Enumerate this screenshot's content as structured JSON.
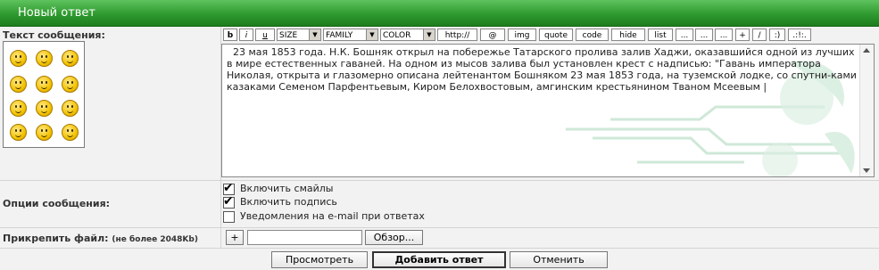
{
  "header": {
    "title": "Новый ответ"
  },
  "labels": {
    "message_text": "Текст сообщения:",
    "options": "Опции сообщения:",
    "attach": "Прикрепить файл:",
    "attach_limit": "(не более 2048Kb)"
  },
  "smilies": [
    "smile-icon",
    "grin-icon",
    "cool-icon",
    "scared-icon",
    "unsure-icon",
    "happy-icon",
    "sad-icon",
    "blink-icon",
    "shocked-icon",
    "tongue-icon",
    "rolleyes-icon",
    "wink-icon"
  ],
  "toolbar": {
    "buttons": [
      "b",
      "i",
      "u"
    ],
    "size_select": "SIZE",
    "family_select": "FAMILY",
    "color_select": "COLOR",
    "tags": [
      "http://",
      "@",
      "img",
      "quote",
      "code",
      "hide",
      "list",
      "...",
      "...",
      "...",
      "+",
      "/",
      ":)",
      ".:!:."
    ]
  },
  "editor": {
    "text": "23 мая 1853 года. Н.К. Бошняк открыл на побережье Татарского пролива залив Хаджи, оказавшийся одной из лучших в мире естественных гаваней. На одном из мысов залива был установлен крест с надписью: \"Гавань императора Николая, открыта и глазомерно описана лейтенантом Бошняком 23 мая 1853 года, на туземской лодке, со спутни-ками казаками Семеном Парфентьевым, Киром Белохвостовым, амгинским крестьянином Тваном Мсеевым |"
  },
  "options": [
    {
      "label": "Включить смайлы",
      "checked": true
    },
    {
      "label": "Включить подпись",
      "checked": true
    },
    {
      "label": "Уведомления на e-mail при ответах",
      "checked": false
    }
  ],
  "attach": {
    "add_label": "+",
    "browse_label": "Обзор..."
  },
  "actions": {
    "preview": "Просмотреть",
    "submit": "Добавить ответ",
    "cancel": "Отменить"
  }
}
